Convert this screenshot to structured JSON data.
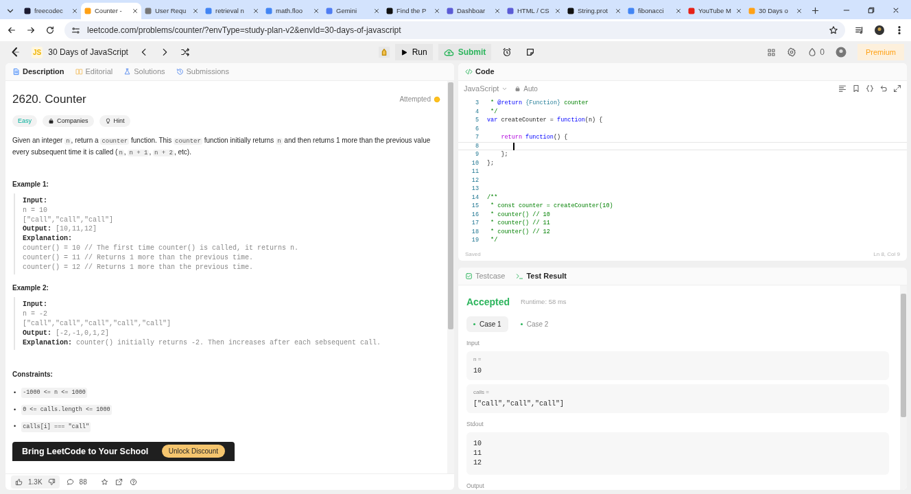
{
  "browser": {
    "tabs": [
      {
        "title": "freecodec",
        "selected": false
      },
      {
        "title": "Counter -",
        "selected": true
      },
      {
        "title": "User Requ",
        "selected": false
      },
      {
        "title": "retrieval n",
        "selected": false
      },
      {
        "title": "math.floo",
        "selected": false
      },
      {
        "title": "Gemini",
        "selected": false
      },
      {
        "title": "Find the P",
        "selected": false
      },
      {
        "title": "Dashboar",
        "selected": false
      },
      {
        "title": "HTML / CS",
        "selected": false
      },
      {
        "title": "String.prot",
        "selected": false
      },
      {
        "title": "fibonacci",
        "selected": false
      },
      {
        "title": "YouTube M",
        "selected": false
      },
      {
        "title": "30 Days o",
        "selected": false
      }
    ],
    "url": "leetcode.com/problems/counter/?envType=study-plan-v2&envId=30-days-of-javascript"
  },
  "toolbar": {
    "badge": "JS",
    "study_plan": "30 Days of JavaScript",
    "run": "Run",
    "submit": "Submit",
    "streak": "0",
    "premium": "Premium"
  },
  "description": {
    "tabs": [
      {
        "label": "Description",
        "selected": true
      },
      {
        "label": "Editorial",
        "selected": false
      },
      {
        "label": "Solutions",
        "selected": false
      },
      {
        "label": "Submissions",
        "selected": false
      }
    ],
    "title": "2620. Counter",
    "status": "Attempted",
    "tags": [
      {
        "label": "Easy",
        "kind": "difficulty"
      },
      {
        "label": "Companies",
        "kind": "companies"
      },
      {
        "label": "Hint",
        "kind": "hint"
      }
    ],
    "paragraph": [
      {
        "text": "Given an integer ",
        "kind": "text"
      },
      {
        "text": "n",
        "kind": "code"
      },
      {
        "text": ", return a ",
        "kind": "text"
      },
      {
        "text": "counter",
        "kind": "code"
      },
      {
        "text": " function. This ",
        "kind": "text"
      },
      {
        "text": "counter",
        "kind": "code"
      },
      {
        "text": " function initially returns ",
        "kind": "text"
      },
      {
        "text": "n",
        "kind": "code"
      },
      {
        "text": " and then returns 1 more than the previous value every subsequent time it is called (",
        "kind": "text"
      },
      {
        "text": "n",
        "kind": "code"
      },
      {
        "text": ", ",
        "kind": "text"
      },
      {
        "text": "n + 1",
        "kind": "code"
      },
      {
        "text": ", ",
        "kind": "text"
      },
      {
        "text": "n + 2",
        "kind": "code"
      },
      {
        "text": ", etc).",
        "kind": "text"
      }
    ],
    "examples": [
      {
        "heading": "Example 1:",
        "lines": [
          {
            "label": "Input:"
          },
          {
            "value": "n = 10"
          },
          {
            "value": "[\"call\",\"call\",\"call\"]"
          },
          {
            "label": "Output:",
            "value": "[10,11,12]"
          },
          {
            "label": "Explanation:"
          },
          {
            "value": "counter() = 10 // The first time counter() is called, it returns n."
          },
          {
            "value": "counter() = 11 // Returns 1 more than the previous time."
          },
          {
            "value": "counter() = 12 // Returns 1 more than the previous time."
          }
        ]
      },
      {
        "heading": "Example 2:",
        "lines": [
          {
            "label": "Input:"
          },
          {
            "value": "n = -2"
          },
          {
            "value": "[\"call\",\"call\",\"call\",\"call\",\"call\"]"
          },
          {
            "label": "Output:",
            "value": "[-2,-1,0,1,2]"
          },
          {
            "label": "Explanation:",
            "value": "counter() initially returns -2. Then increases after each sebsequent call."
          }
        ]
      }
    ],
    "constraints_heading": "Constraints:",
    "constraints": [
      {
        "marker": "•",
        "text": "-1000 <= n <= 1000"
      },
      {
        "marker": "•",
        "text": "0 <= calls.length <= 1000"
      },
      {
        "marker": "•",
        "text": "calls[i] === \"call\""
      }
    ],
    "banner": {
      "title": "Bring **LeetCode** to Your School",
      "button": "Unlock Discount"
    },
    "footer": {
      "likes": "1.3K",
      "comments": "88"
    }
  },
  "editor": {
    "title": "Code",
    "language": "JavaScript",
    "mode": "Auto",
    "lines": [
      {
        "number": "3",
        "current": false,
        "tokens": [
          {
            "text": " * ",
            "kind": "comment"
          },
          {
            "text": "@return",
            "kind": "doc-tag"
          },
          {
            "text": " {Function}",
            "kind": "doc-type"
          },
          {
            "text": " counter",
            "kind": "comment"
          }
        ]
      },
      {
        "number": "4",
        "current": false,
        "tokens": [
          {
            "text": " */",
            "kind": "comment"
          }
        ]
      },
      {
        "number": "5",
        "current": false,
        "tokens": [
          {
            "text": "var",
            "kind": "keyword"
          },
          {
            "text": " createCounter = ",
            "kind": "plain"
          },
          {
            "text": "function",
            "kind": "keyword"
          },
          {
            "text": "(n) {",
            "kind": "plain"
          }
        ]
      },
      {
        "number": "6",
        "current": false
      },
      {
        "number": "7",
        "current": false,
        "tokens": [
          {
            "text": "    return",
            "kind": "control"
          },
          {
            "text": " function",
            "kind": "keyword"
          },
          {
            "text": "() {",
            "kind": "plain"
          }
        ]
      },
      {
        "number": "8",
        "current": true
      },
      {
        "number": "9",
        "current": false,
        "tokens": [
          {
            "text": "    };",
            "kind": "plain"
          }
        ]
      },
      {
        "number": "10",
        "current": false,
        "tokens": [
          {
            "text": "};",
            "kind": "plain"
          }
        ]
      },
      {
        "number": "11",
        "current": false
      },
      {
        "number": "12",
        "current": false
      },
      {
        "number": "13",
        "current": false
      },
      {
        "number": "14",
        "current": false,
        "tokens": [
          {
            "text": "/**",
            "kind": "comment"
          }
        ]
      },
      {
        "number": "15",
        "current": false,
        "tokens": [
          {
            "text": " * const counter = createCounter(10)",
            "kind": "comment"
          }
        ]
      },
      {
        "number": "16",
        "current": false,
        "tokens": [
          {
            "text": " * counter() // 10",
            "kind": "comment"
          }
        ]
      },
      {
        "number": "17",
        "current": false,
        "tokens": [
          {
            "text": " * counter() // 11",
            "kind": "comment"
          }
        ]
      },
      {
        "number": "18",
        "current": false,
        "tokens": [
          {
            "text": " * counter() // 12",
            "kind": "comment"
          }
        ]
      },
      {
        "number": "19",
        "current": false,
        "tokens": [
          {
            "text": " */",
            "kind": "comment"
          }
        ]
      }
    ],
    "status": "Saved",
    "position": "Ln 8, Col 9"
  },
  "results": {
    "tabs": [
      {
        "label": "Testcase",
        "selected": false
      },
      {
        "label": "Test Result",
        "selected": true
      }
    ],
    "verdict": "Accepted",
    "runtime": "Runtime: 58 ms",
    "cases": [
      {
        "label": "Case 1",
        "selected": true
      },
      {
        "label": "Case 2",
        "selected": false
      }
    ],
    "input_heading": "Input",
    "inputs": [
      {
        "name": "n =",
        "value": "10"
      },
      {
        "name": "calls =",
        "value": "[\"call\",\"call\",\"call\"]"
      }
    ],
    "stdout_heading": "Stdout",
    "stdout": [
      "10",
      "11",
      "12"
    ],
    "output_heading": "Output"
  }
}
